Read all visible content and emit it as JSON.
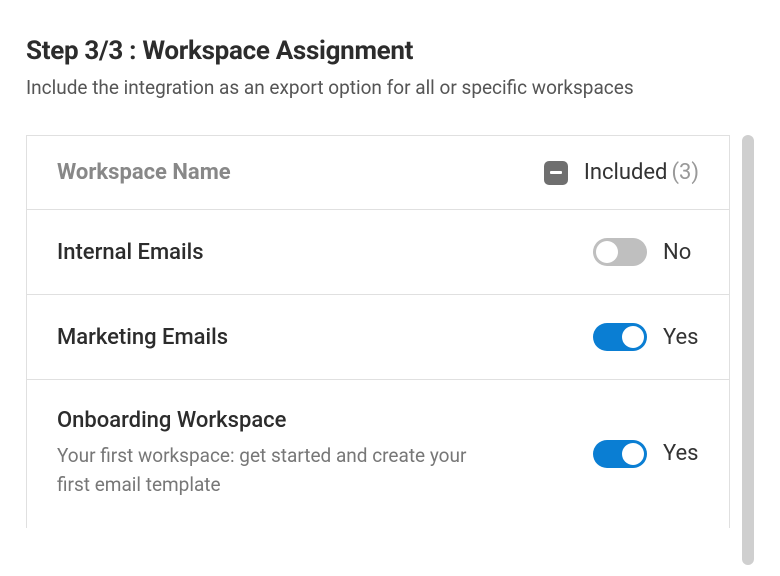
{
  "header": {
    "title": "Step 3/3 : Workspace Assignment",
    "subtitle": "Include the integration as an export option for all or specific workspaces"
  },
  "table": {
    "col_name": "Workspace Name",
    "included_label": "Included",
    "included_count": "(3)"
  },
  "rows": [
    {
      "title": "Internal Emails",
      "desc": "",
      "included": false,
      "label": "No"
    },
    {
      "title": "Marketing Emails",
      "desc": "",
      "included": true,
      "label": "Yes"
    },
    {
      "title": "Onboarding Workspace",
      "desc": "Your first workspace: get started and create your first email template",
      "included": true,
      "label": "Yes"
    }
  ]
}
